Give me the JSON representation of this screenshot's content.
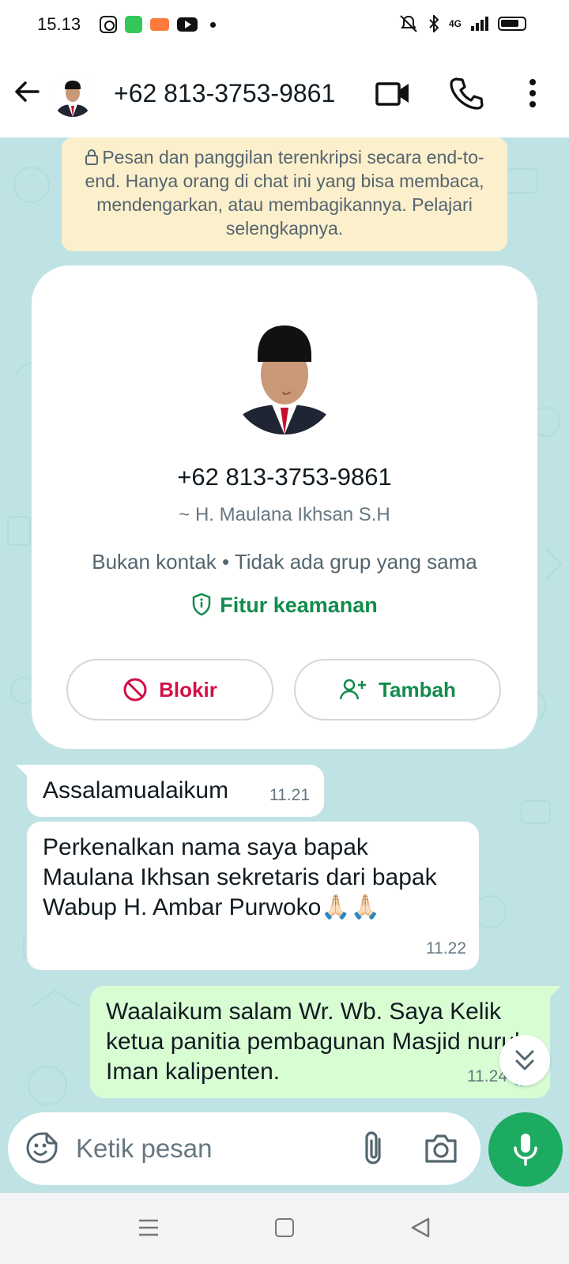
{
  "status_bar": {
    "time": "15.13",
    "network": "4G"
  },
  "header": {
    "title": "+62 813-3753-9861"
  },
  "encryption_note": {
    "text": "Pesan dan panggilan terenkripsi secara end-to-end. Hanya orang di chat ini yang bisa membaca, mendengarkan, atau membagikannya. Pelajari selengkapnya."
  },
  "profile_card": {
    "phone": "+62 813-3753-9861",
    "name": "~ H. Maulana Ikhsan S.H",
    "info": "Bukan kontak • Tidak ada grup yang sama",
    "security_label": "Fitur keamanan",
    "block_label": "Blokir",
    "add_label": "Tambah"
  },
  "messages": [
    {
      "direction": "incoming",
      "text": "Assalamualaikum",
      "time": "11.21"
    },
    {
      "direction": "incoming",
      "text": "Perkenalkan nama saya bapak Maulana Ikhsan sekretaris dari bapak Wabup H. Ambar Purwoko🙏🏻🙏🏻",
      "time": "11.22"
    },
    {
      "direction": "outgoing",
      "text": "Waalaikum salam Wr. Wb. Saya Kelik ketua panitia pembagunan Masjid nurul Iman kalipenten.",
      "time": "11.24",
      "status": "read"
    }
  ],
  "composer": {
    "placeholder": "Ketik pesan"
  },
  "icons": {
    "back": "arrow-left-icon",
    "video": "video-call-icon",
    "call": "phone-icon",
    "more": "more-vertical-icon",
    "lock": "lock-icon",
    "shield": "shield-icon",
    "block": "block-icon",
    "add_person": "add-person-icon",
    "scroll_down": "chevron-double-down-icon",
    "emoji": "sticker-icon",
    "attach": "paperclip-icon",
    "camera": "camera-icon",
    "mic": "mic-icon"
  },
  "colors": {
    "accent": "#1daa61",
    "chat_background": "#bfe3e4",
    "outgoing_bubble": "#d9fdd3",
    "encryption_note_bg": "#fcefcc",
    "block_red": "#d21046",
    "link_green": "#128c4c"
  }
}
